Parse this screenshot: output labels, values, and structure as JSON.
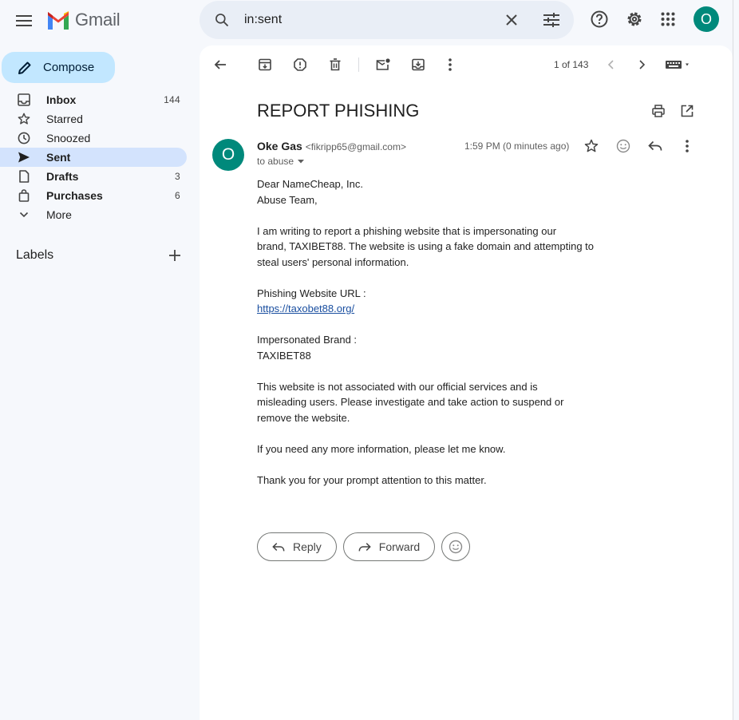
{
  "app": {
    "name": "Gmail"
  },
  "search": {
    "value": "in:sent"
  },
  "account": {
    "initial": "O"
  },
  "compose": {
    "label": "Compose"
  },
  "nav": [
    {
      "label": "Inbox",
      "count": "144",
      "bold": true,
      "active": false,
      "icon": "inbox-icon"
    },
    {
      "label": "Starred",
      "count": "",
      "bold": false,
      "active": false,
      "icon": "star-icon"
    },
    {
      "label": "Snoozed",
      "count": "",
      "bold": false,
      "active": false,
      "icon": "clock-icon"
    },
    {
      "label": "Sent",
      "count": "",
      "bold": true,
      "active": true,
      "icon": "send-icon"
    },
    {
      "label": "Drafts",
      "count": "3",
      "bold": true,
      "active": false,
      "icon": "draft-icon"
    },
    {
      "label": "Purchases",
      "count": "6",
      "bold": true,
      "active": false,
      "icon": "bag-icon"
    },
    {
      "label": "More",
      "count": "",
      "bold": false,
      "active": false,
      "icon": "chevron-down-icon"
    }
  ],
  "labels": {
    "heading": "Labels"
  },
  "toolbar": {
    "page_count": "1 of 143"
  },
  "email": {
    "subject": "REPORT PHISHING",
    "sender_initial": "O",
    "sender_name": "Oke Gas",
    "sender_email": "<fikripp65@gmail.com>",
    "to": "to abuse",
    "time": "1:59 PM (0 minutes ago)",
    "body": {
      "l1": "Dear NameCheap, Inc.",
      "l2": "Abuse Team,",
      "l3": "I am writing to report a phishing website that is impersonating our",
      "l4": "brand, TAXIBET88. The website is using a fake domain and attempting to",
      "l5": "steal users' personal information.",
      "l6": "Phishing Website URL :",
      "link": "https://taxobet88.org/",
      "l7": "Impersonated Brand :",
      "l8": "TAXIBET88",
      "l9": "This website is not associated with our official services and is",
      "l10": "misleading users. Please investigate and take action to suspend or",
      "l11": "remove the website.",
      "l12": "If you need any more information, please let me know.",
      "l13": "Thank you for your prompt attention to this matter."
    }
  },
  "actions": {
    "reply": "Reply",
    "forward": "Forward"
  },
  "colors": {
    "accent": "#c2e7ff",
    "active_nav": "#d3e3fd",
    "avatar": "#00897b",
    "search_bg": "#e9eef6"
  }
}
